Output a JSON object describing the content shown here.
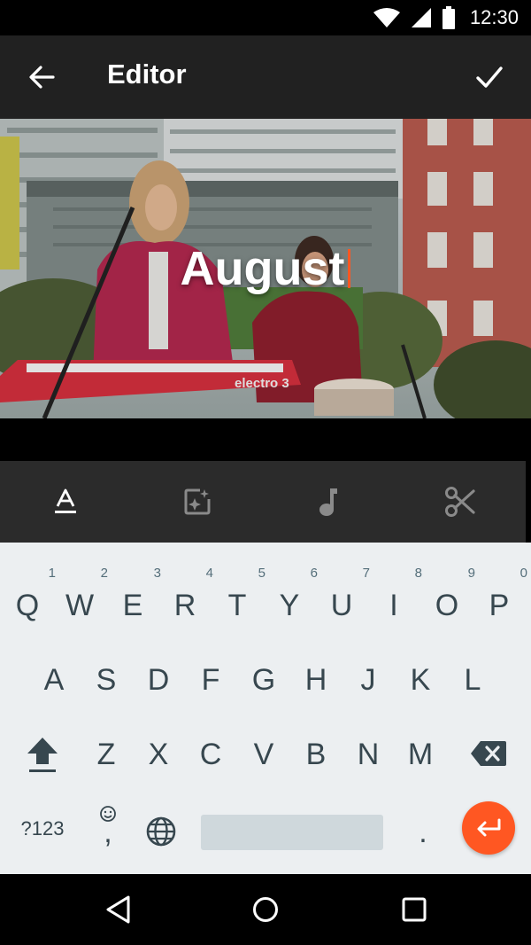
{
  "status_bar": {
    "time": "12:30"
  },
  "app_bar": {
    "title": "Editor"
  },
  "video": {
    "caption": "August",
    "overlay_text": "electro 3"
  },
  "toolbar": {
    "tabs": [
      "text",
      "sticker",
      "music",
      "trim"
    ],
    "active_tab": "text"
  },
  "keyboard": {
    "row1": [
      {
        "key": "Q",
        "hint": "1"
      },
      {
        "key": "W",
        "hint": "2"
      },
      {
        "key": "E",
        "hint": "3"
      },
      {
        "key": "R",
        "hint": "4"
      },
      {
        "key": "T",
        "hint": "5"
      },
      {
        "key": "Y",
        "hint": "6"
      },
      {
        "key": "U",
        "hint": "7"
      },
      {
        "key": "I",
        "hint": "8"
      },
      {
        "key": "O",
        "hint": "9"
      },
      {
        "key": "P",
        "hint": "0"
      }
    ],
    "row2": [
      "A",
      "S",
      "D",
      "F",
      "G",
      "H",
      "J",
      "K",
      "L"
    ],
    "row3": [
      "Z",
      "X",
      "C",
      "V",
      "B",
      "N",
      "M"
    ],
    "symbols_label": "?123",
    "comma_label": ",",
    "period_label": "."
  },
  "colors": {
    "accent": "#ff5722",
    "app_bar": "#212121",
    "toolbar": "#2b2b2b",
    "keyboard": "#eceff1",
    "key_text": "#37474f"
  }
}
